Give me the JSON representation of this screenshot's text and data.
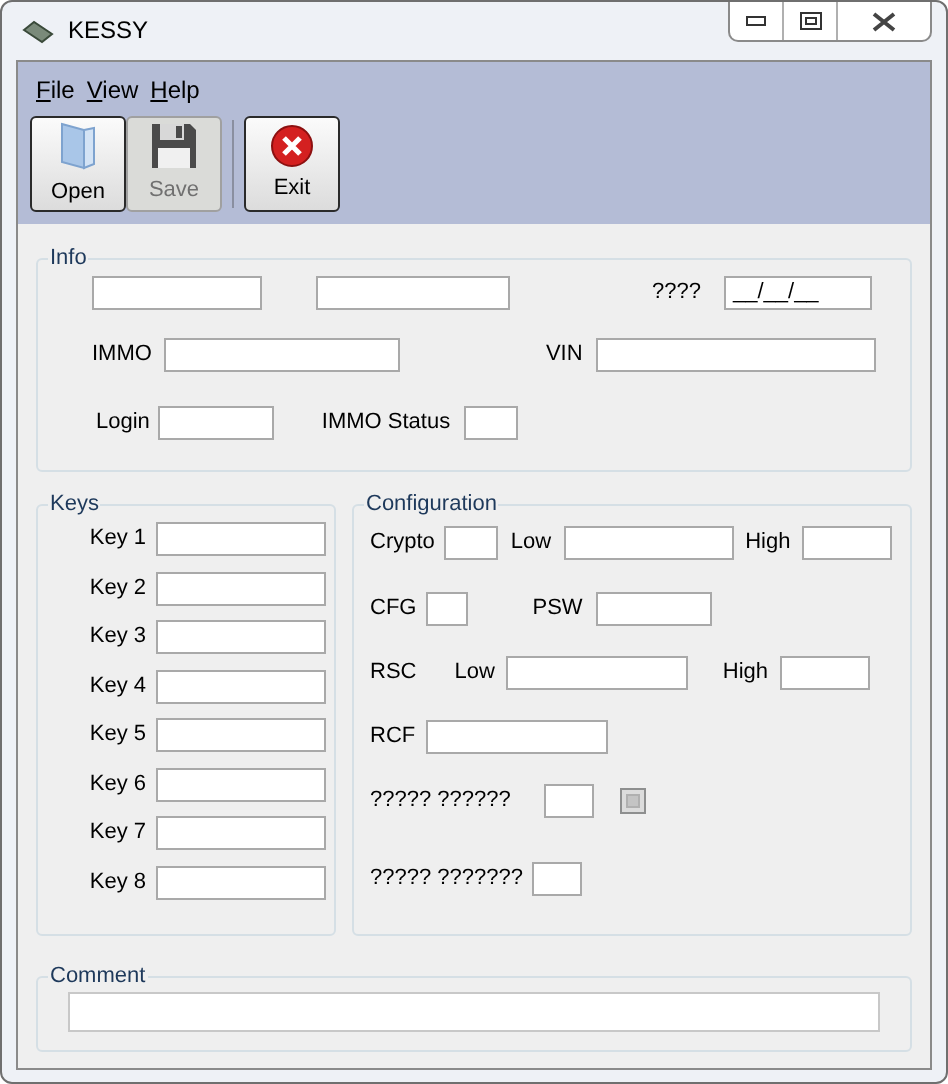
{
  "window": {
    "title": "KESSY"
  },
  "menu": [
    {
      "label": "File"
    },
    {
      "label": "View"
    },
    {
      "label": "Help"
    }
  ],
  "toolbar": [
    {
      "kind": "open",
      "label": "Open",
      "disabled": false
    },
    {
      "kind": "save",
      "label": "Save",
      "disabled": true
    },
    {
      "kind": "separator"
    },
    {
      "kind": "exit",
      "label": "Exit",
      "disabled": false
    }
  ],
  "info": {
    "title": "Info",
    "date_label": "????",
    "date_value": "__/__/__",
    "immo_label": "IMMO",
    "vin_label": "VIN",
    "login_label": "Login",
    "immo_status_label": "IMMO Status"
  },
  "keys": {
    "title": "Keys",
    "items": [
      {
        "label": "Key 1"
      },
      {
        "label": "Key 2"
      },
      {
        "label": "Key 3"
      },
      {
        "label": "Key 4"
      },
      {
        "label": "Key 5"
      },
      {
        "label": "Key 6"
      },
      {
        "label": "Key 7"
      },
      {
        "label": "Key 8"
      }
    ]
  },
  "configuration": {
    "title": "Configuration",
    "crypto_label": "Crypto",
    "crypto_low_label": "Low",
    "crypto_high_label": "High",
    "cfg_label": "CFG",
    "psw_label": "PSW",
    "rsc_label": "RSC",
    "rsc_low_label": "Low",
    "rsc_high_label": "High",
    "rcf_label": "RCF",
    "option_1": {
      "label": "????? ??????",
      "checked": false
    },
    "option_2_label": "????? ???????"
  },
  "comment": {
    "title": "Comment"
  }
}
